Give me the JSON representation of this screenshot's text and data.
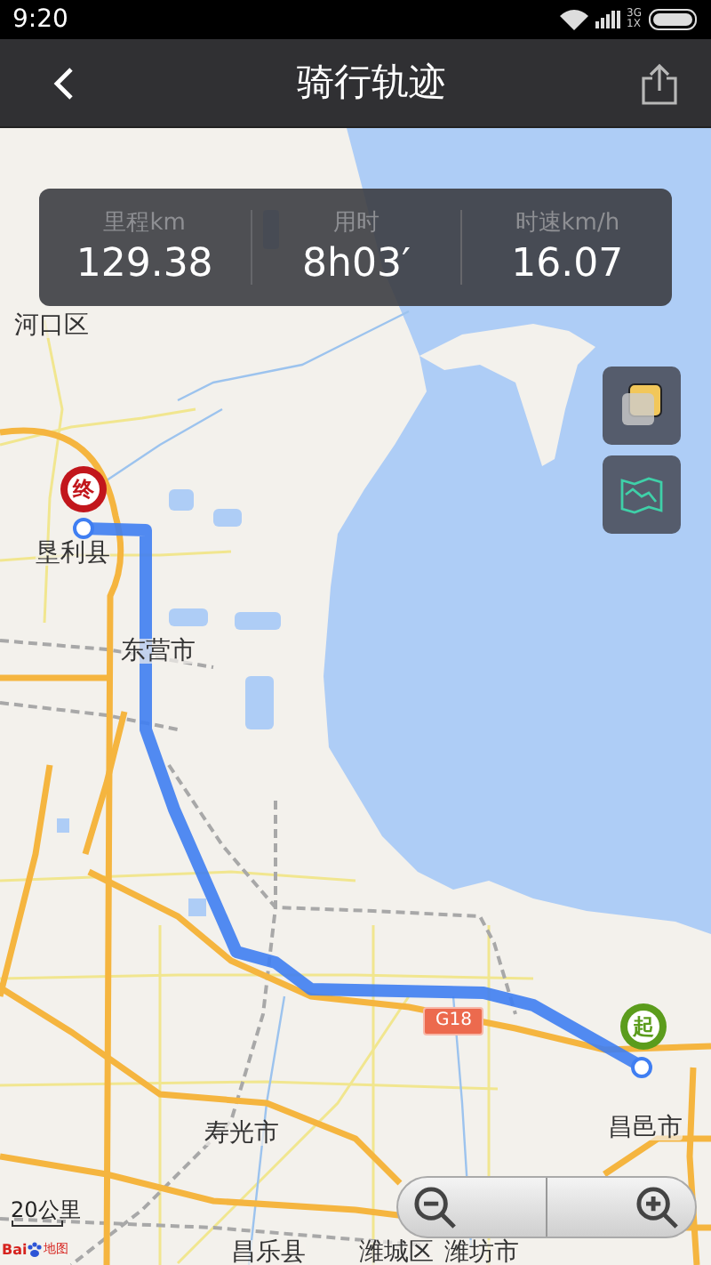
{
  "status_bar": {
    "time": "9:20",
    "network_top": "3G",
    "network_bottom": "1X"
  },
  "header": {
    "title": "骑行轨迹"
  },
  "stats": [
    {
      "label": "里程km",
      "value": "129.38"
    },
    {
      "label": "用时",
      "value": "8h03′"
    },
    {
      "label": "时速km/h",
      "value": "16.07"
    }
  ],
  "map": {
    "labels": [
      "河口区",
      "垦利县",
      "东营市",
      "寿光市",
      "昌邑市",
      "昌乐县",
      "潍城区",
      "潍坊市"
    ],
    "road_badge": "G18",
    "markers": [
      {
        "glyph": "终",
        "color": "#c2161c"
      },
      {
        "glyph": "起",
        "color": "#5b9c1c"
      }
    ],
    "scale": "20公里",
    "logo": {
      "left": "Bai",
      "right": "地图"
    }
  }
}
